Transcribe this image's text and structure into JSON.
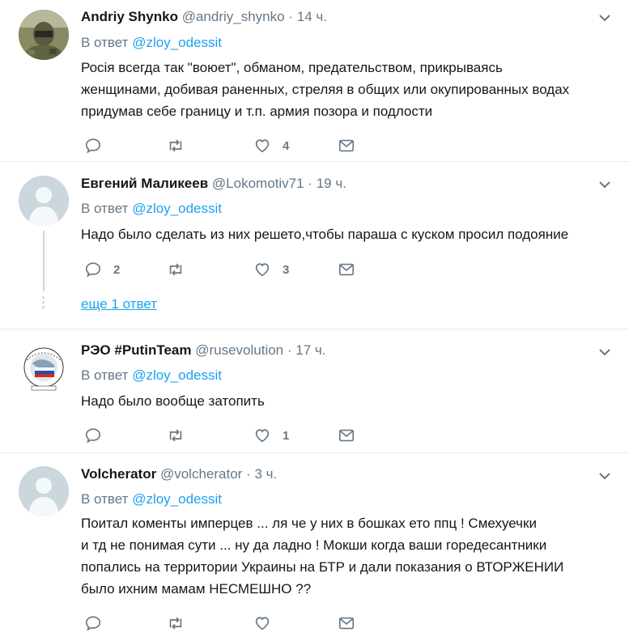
{
  "tweets": [
    {
      "name": "Andriy Shynko",
      "handle": "@andriy_shynko",
      "dot": "·",
      "time": "14 ч.",
      "reply_prefix": "В ответ",
      "reply_to": "@zloy_odessit",
      "lines": [
        "Росія всегда так \"воюет\", обманом, предательством, прикрываясь",
        "женщинами, добивая раненных, стреляя в общих или окупированных водах",
        "придумав себе границу и т.п. армия позора и подлости"
      ],
      "replies": "",
      "retweets": "",
      "likes": "4",
      "avatar": "military-photo"
    },
    {
      "name": "Евгений Маликеев",
      "handle": "@Lokomotiv71",
      "dot": "·",
      "time": "19 ч.",
      "reply_prefix": "В ответ",
      "reply_to": "@zloy_odessit",
      "lines": [
        "Надо было сделать из них решето,чтобы параша  с куском просил подояние"
      ],
      "replies": "2",
      "retweets": "",
      "likes": "3",
      "avatar": "default-avatar",
      "more_replies": "еще 1 ответ"
    },
    {
      "name": "РЭО #PutinTeam",
      "handle": "@rusevolution",
      "dot": "·",
      "time": "17 ч.",
      "reply_prefix": "В ответ",
      "reply_to": "@zloy_odessit",
      "lines": [
        "Надо было вообще затопить"
      ],
      "replies": "",
      "retweets": "",
      "likes": "1",
      "avatar": "globe-flag-logo"
    },
    {
      "name": "Volcherator",
      "handle": "@volcherator",
      "dot": "·",
      "time": "3 ч.",
      "reply_prefix": "В ответ",
      "reply_to": "@zloy_odessit",
      "lines": [
        "Поитал коменты  имперцев ... ля  че  у них в  бошках  ето  ппц ! Смехуечки",
        "и тд  не понимая  сути ...  ну да ладно ! Мокши когда ваши горедесантники",
        "попались на территории Украины на БТР и дали показания о ВТОРЖЕНИИ",
        "было ихним мамам  НЕСМЕШНО ??"
      ],
      "replies": "",
      "retweets": "",
      "likes": "",
      "avatar": "default-avatar"
    }
  ],
  "colors": {
    "accent": "#1da1f2",
    "secondary_text": "#657786",
    "separator": "#e6ecf0",
    "icon": "#657786"
  },
  "icons": [
    "chevron-down-icon",
    "reply-icon",
    "retweet-icon",
    "like-icon",
    "message-icon"
  ]
}
